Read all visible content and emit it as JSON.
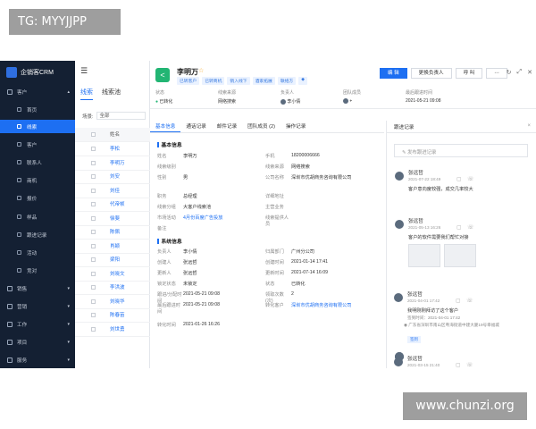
{
  "watermark_top": "TG: MYYJJPP",
  "watermark_bottom": "www.chunzi.org",
  "colors": {
    "sidebar": "#142033",
    "primary": "#1d6ff2",
    "lead_avatar": "#22b573"
  },
  "sidebar": {
    "logo": "企销客CRM",
    "groups": [
      {
        "label": "客户",
        "icon": "user-icon",
        "expanded": true
      },
      {
        "label": "销售",
        "icon": "sales-icon"
      },
      {
        "label": "营销",
        "icon": "marketing-icon"
      },
      {
        "label": "工作",
        "icon": "work-icon"
      },
      {
        "label": "项目",
        "icon": "project-icon"
      },
      {
        "label": "服务",
        "icon": "service-icon"
      }
    ],
    "items": [
      {
        "label": "首页"
      },
      {
        "label": "线索",
        "active": true
      },
      {
        "label": "客户"
      },
      {
        "label": "联系人"
      },
      {
        "label": "商机"
      },
      {
        "label": "报价"
      },
      {
        "label": "样品"
      },
      {
        "label": "跟进记录"
      },
      {
        "label": "活动"
      },
      {
        "label": "竞对"
      }
    ]
  },
  "list": {
    "tabs": [
      "线索",
      "线索池"
    ],
    "filter_label": "场景:",
    "filter_value": "全部",
    "header": "姓名",
    "rows": [
      "李松",
      "李明万",
      "刘安",
      "刘佳",
      "代帝帧",
      "徐斐",
      "陈佩",
      "肖颖",
      "梁阳",
      "刘晓文",
      "李洪波",
      "刘晓华",
      "陈春苗",
      "刘世勇"
    ]
  },
  "header": {
    "name": "李明万",
    "chips": [
      "已转客户",
      "已转商机",
      "销入线下",
      "酒家拓展",
      "联络方"
    ],
    "buttons": [
      "编 辑",
      "更换负责人",
      "呼 叫"
    ],
    "more": "⋯",
    "meta": [
      {
        "k": "状态",
        "v": "已转化"
      },
      {
        "k": "线索来源",
        "v": "网络搜索"
      },
      {
        "k": "负责人",
        "v": "李小倩"
      },
      {
        "k": "团队成员",
        "v": "+"
      },
      {
        "k": "最后跟进时间",
        "v": "2021-05-21 09:08"
      }
    ]
  },
  "detail": {
    "tabs": [
      "基本信息",
      "通话记录",
      "邮件记录",
      "团队成员 (2)",
      "操作记录"
    ],
    "basic_title": "基本信息",
    "basic": [
      [
        "姓名",
        "李明万",
        "手机",
        "18200006666"
      ],
      [
        "线索级别",
        "",
        "线索来源",
        "网络搜索"
      ],
      [
        "性别",
        "男",
        "公司名称",
        "深圳市优胡商务咨询有限公司"
      ],
      [
        "职务",
        "总经理",
        "详细地址",
        ""
      ],
      [
        "线索分组",
        "大客户线索池",
        "主营业务",
        ""
      ],
      [
        "市场活动",
        "4月份百度广告投放",
        "线索提供人员",
        ""
      ],
      [
        "备注",
        "",
        "",
        ""
      ]
    ],
    "system_title": "系统信息",
    "system": [
      [
        "负责人",
        "李小倩",
        "归属部门",
        "广州分公司"
      ],
      [
        "创建人",
        "张远哲",
        "创建时间",
        "2021-01-14 17:41"
      ],
      [
        "更新人",
        "张远哲",
        "更新时间",
        "2021-07-14 16:09"
      ],
      [
        "锁定状态",
        "未锁定",
        "状态",
        "已转化"
      ],
      [
        "跟进/分配时间",
        "2021-05-21 09:08",
        "领取次数(次)",
        "2"
      ],
      [
        "最后跟进时间",
        "2021-05-21 09:08",
        "转化客户",
        "深圳市优胡商务咨询有限公司"
      ],
      [
        "转化时间",
        "2021-01-26 16:26",
        "",
        ""
      ]
    ]
  },
  "follow": {
    "title": "跟进记录",
    "input_placeholder": "发布跟进记录",
    "entries": [
      {
        "name": "张远哲",
        "time": "2021-07-22 18:49",
        "text": "客户意向度较强，成交几率较大"
      },
      {
        "name": "张远哲",
        "time": "2021-05-13 16:26",
        "text": "客户的软件需要我们帮忙对接"
      },
      {
        "name": "张远哲",
        "time": "2021-04-01 17:42",
        "text": "我明刚刚拜访了这个客户",
        "sub": "签到时间：2021-04-01 17:42",
        "addr": "广东省深圳市南山区粤海街道中建大厦19号幸福城",
        "tag": "签到"
      },
      {
        "name": "张远哲",
        "time": "2021-03-15 21:40"
      }
    ]
  }
}
